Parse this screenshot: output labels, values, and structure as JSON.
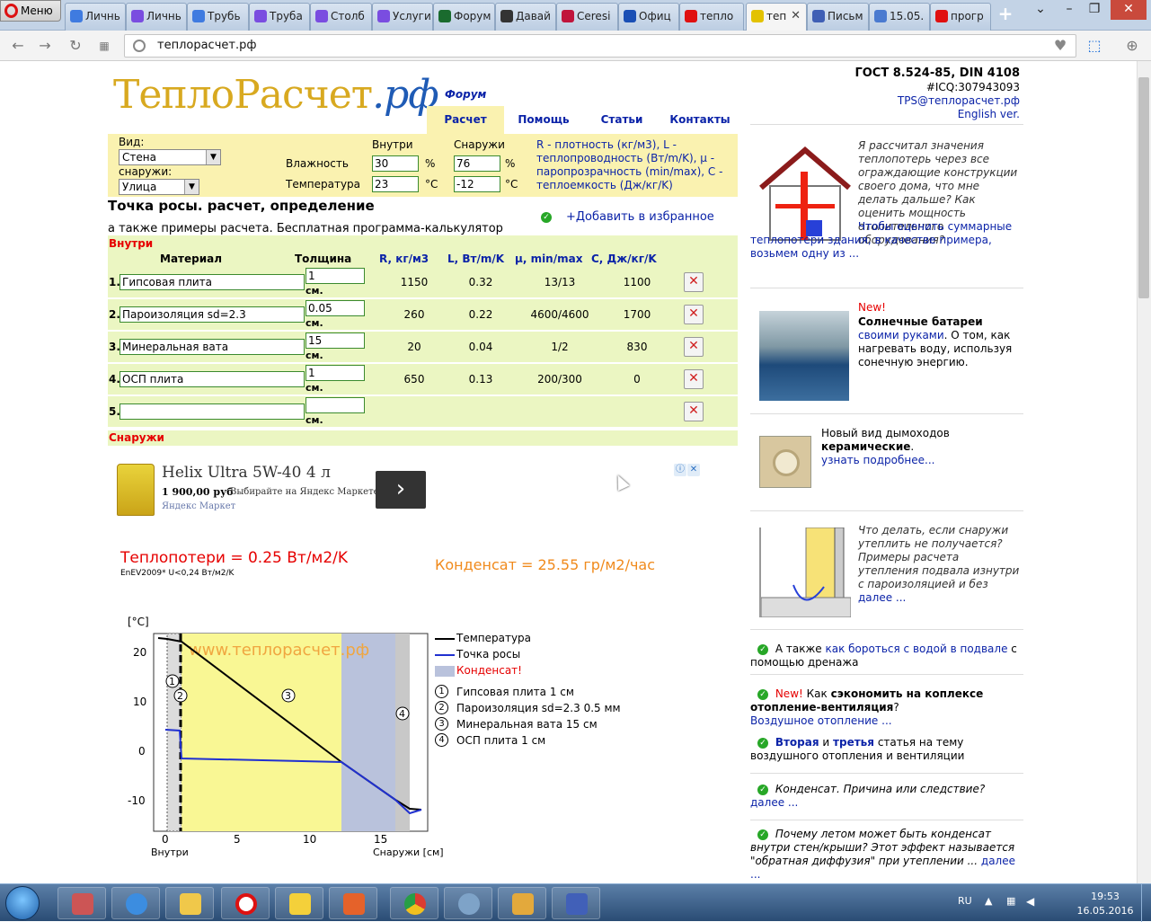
{
  "browser": {
    "menu_label": "Меню",
    "tabs": [
      {
        "label": "Личнь",
        "color": "#3f7be0"
      },
      {
        "label": "Личнь",
        "color": "#7a4de0"
      },
      {
        "label": "Трубь",
        "color": "#3f7be0"
      },
      {
        "label": "Труба",
        "color": "#7a4de0"
      },
      {
        "label": "Столб",
        "color": "#7a4de0"
      },
      {
        "label": "Услуги",
        "color": "#7a4de0"
      },
      {
        "label": "Форум",
        "color": "#1a6b2e"
      },
      {
        "label": "Давай",
        "color": "#333333"
      },
      {
        "label": "Ceresi",
        "color": "#c0143c"
      },
      {
        "label": "Офиц",
        "color": "#1a4fb5"
      },
      {
        "label": "тепло",
        "color": "#e01010"
      },
      {
        "label": "теп",
        "color": "#e3c200"
      },
      {
        "label": "Письм",
        "color": "#3f5fb5"
      },
      {
        "label": "15.05.",
        "color": "#4a7ad0"
      },
      {
        "label": "прогр",
        "color": "#e01010"
      }
    ],
    "new_tab": "+",
    "url": "теплорасчет.рф"
  },
  "site": {
    "logo_main": "ТеплоРасчет",
    "logo_rf": ".рф",
    "forum": "Форум",
    "nav": [
      "Расчет",
      "Помощь",
      "Статьи",
      "Контакты"
    ],
    "gost": "ГОСТ 8.524-85, DIN 4108",
    "icq": "#ICQ:307943093",
    "email": "TPS@теплорасчет.рф",
    "english": "English ver."
  },
  "form": {
    "type_label": "Вид:",
    "type_value": "Стена",
    "outside_label": "снаружи:",
    "outside_value": "Улица",
    "inside_hdr": "Внутри",
    "outside_hdr": "Снаружи",
    "humidity_label": "Влажность",
    "temp_label": "Температура",
    "hum_in": "30",
    "hum_out": "76",
    "temp_in": "23",
    "temp_out": "-12",
    "pct": "%",
    "deg": "°C",
    "legend": "R - плотность (кг/м3), L - теплопроводность (Вт/m/K), μ - паропрозрачность (min/max), C - теплоемкость (Дж/кг/K)"
  },
  "heading": "Точка росы. расчет, определение",
  "subheading": "а также примеры расчета. Бесплатная программа-калькулятор",
  "favorite": "+Добавить в избранное",
  "inside_label": "Внутри",
  "outside_label": "Снаружи",
  "table": {
    "headers": [
      "Материал",
      "Толщина",
      "R, кг/м3",
      "L, Вт/m/K",
      "μ, min/max",
      "C, Дж/кг/K"
    ],
    "unit": "см.",
    "rows": [
      {
        "n": "1.",
        "material": "Гипсовая плита",
        "thickness": "1",
        "r": "1150",
        "l": "0.32",
        "mu": "13/13",
        "c": "1100"
      },
      {
        "n": "2.",
        "material": "Пароизоляция sd=2.3",
        "thickness": "0.05",
        "r": "260",
        "l": "0.22",
        "mu": "4600/4600",
        "c": "1700"
      },
      {
        "n": "3.",
        "material": "Минеральная вата",
        "thickness": "15",
        "r": "20",
        "l": "0.04",
        "mu": "1/2",
        "c": "830"
      },
      {
        "n": "4.",
        "material": "ОСП плита",
        "thickness": "1",
        "r": "650",
        "l": "0.13",
        "mu": "200/300",
        "c": "0"
      },
      {
        "n": "5.",
        "material": "",
        "thickness": "",
        "r": "",
        "l": "",
        "mu": "",
        "c": ""
      }
    ]
  },
  "ad": {
    "title": "Helix Ultra 5W-40 4 л",
    "price": "1 900,00 руб",
    "desc": "Выбирайте на Яндекс Маркете!",
    "source": "Яндекс Маркет"
  },
  "results": {
    "heatloss": "Теплопотери = 0.25 Вт/м2/K",
    "heatloss_note": "EnEV2009* U<0,24 Вт/м2/K",
    "condensate": "Конденсат = 25.55 гр/м2/час"
  },
  "chart": {
    "y_unit": "[°C]",
    "watermark": "www.теплорасчет.рф",
    "x_left": "Внутри",
    "x_right": "Снаружи [см]",
    "yticks": [
      "20",
      "10",
      "0",
      "-10"
    ],
    "xticks": [
      "0",
      "5",
      "10",
      "15"
    ],
    "legend_temp": "Температура",
    "legend_dew": "Точка росы",
    "legend_cond": "Конденсат!",
    "layers": [
      {
        "n": "1",
        "label": "Гипсовая плита 1 см"
      },
      {
        "n": "2",
        "label": "Пароизоляция sd=2.3 0.5 мм"
      },
      {
        "n": "3",
        "label": "Минеральная вата 15 см"
      },
      {
        "n": "4",
        "label": "ОСП плита 1 см"
      }
    ]
  },
  "sidebar": {
    "item1": "Я рассчитал значения теплопотерь через все ограждающие конструкции своего дома, что мне делать дальше? Как оценить мощность отопительного оборудования?",
    "item1_link": "Чтобы оценить суммарные теплопотери здания, в качестве примера, возьмем одну из ...",
    "item2_new": "New!",
    "item2_title": "Солнечные батареи",
    "item2_link": "своими руками",
    "item2_text": ". О том, как нагревать воду, используя сонечную энергию.",
    "item3_text": "Новый вид дымоходов",
    "item3_bold": "керамические",
    "item3_link": "узнать подробнее...",
    "item4_text": "Что делать, если снаружи утеплить не получается? Примеры расчета утепления подвала изнутри с пароизоляцией и без",
    "item4_link": "далее ...",
    "item5_pre": "А также",
    "item5_link": "как бороться с водой в подвале",
    "item5_post": "с помощью дренажа",
    "item6_new": "New!",
    "item6_pre": "Как",
    "item6_bold": "сэкономить на коплексе отопление-вентиляция",
    "item6_post": "?",
    "item6_link": "Воздушное отопление ...",
    "item7_b1": "Вторая",
    "item7_and": "и",
    "item7_b2": "третья",
    "item7_text": "статья на тему воздушного отопления и вентиляции",
    "item8_text": "Конденсат. Причина или следствие?",
    "item8_link": "далее ...",
    "item9_text": "Почему летом может быть конденсат внутри стен/крыши? Этот эффект называется \"обратная диффузия\" при утеплении ...",
    "item9_link": "далее ..."
  },
  "taskbar": {
    "lang": "RU",
    "time": "19:53",
    "date": "16.05.2016"
  }
}
